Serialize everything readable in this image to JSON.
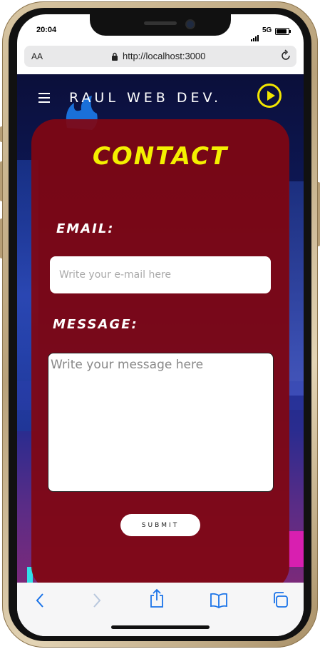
{
  "status_bar": {
    "time": "20:04",
    "network": "5G"
  },
  "browser": {
    "text_size_label": "AA",
    "url": "http://localhost:3000"
  },
  "site": {
    "brand": "RAUL WEB DEV.",
    "contact_title": "CONTACT",
    "email_label": "EMAIL:",
    "email_placeholder": "Write your e-mail here",
    "message_label": "MESSAGE:",
    "message_placeholder": "Write your message here",
    "submit_label": "SUBMIT"
  },
  "colors": {
    "accent_yellow": "#f4f000",
    "card": "#800612",
    "link_blue": "#1a73e8"
  },
  "toolbar": {
    "icons": [
      "back-icon",
      "forward-icon",
      "share-icon",
      "bookmarks-icon",
      "tabs-icon"
    ]
  }
}
